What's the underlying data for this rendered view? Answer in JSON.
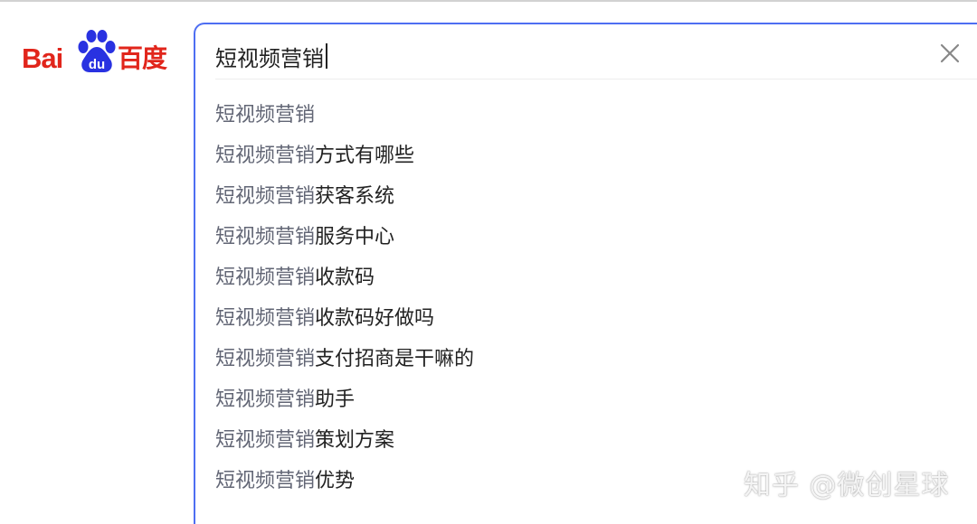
{
  "logo": {
    "latin_text": "Bai",
    "paw_text": "du",
    "chinese_text": "百度",
    "color": "#e1251b",
    "paw_color": "#2932e1"
  },
  "search": {
    "query": "短视频营销",
    "focus_color": "#4e6ef2"
  },
  "suggestions": [
    {
      "prefix": "短视频营销",
      "suffix": ""
    },
    {
      "prefix": "短视频营销",
      "suffix": "方式有哪些"
    },
    {
      "prefix": "短视频营销",
      "suffix": "获客系统"
    },
    {
      "prefix": "短视频营销",
      "suffix": "服务中心"
    },
    {
      "prefix": "短视频营销",
      "suffix": "收款码"
    },
    {
      "prefix": "短视频营销",
      "suffix": "收款码好做吗"
    },
    {
      "prefix": "短视频营销",
      "suffix": "支付招商是干嘛的"
    },
    {
      "prefix": "短视频营销",
      "suffix": "助手"
    },
    {
      "prefix": "短视频营销",
      "suffix": "策划方案"
    },
    {
      "prefix": "短视频营销",
      "suffix": "优势"
    }
  ],
  "watermark": "知乎 @微创星球",
  "icons": {
    "clear": "close-icon",
    "logo_paw": "paw-icon"
  }
}
